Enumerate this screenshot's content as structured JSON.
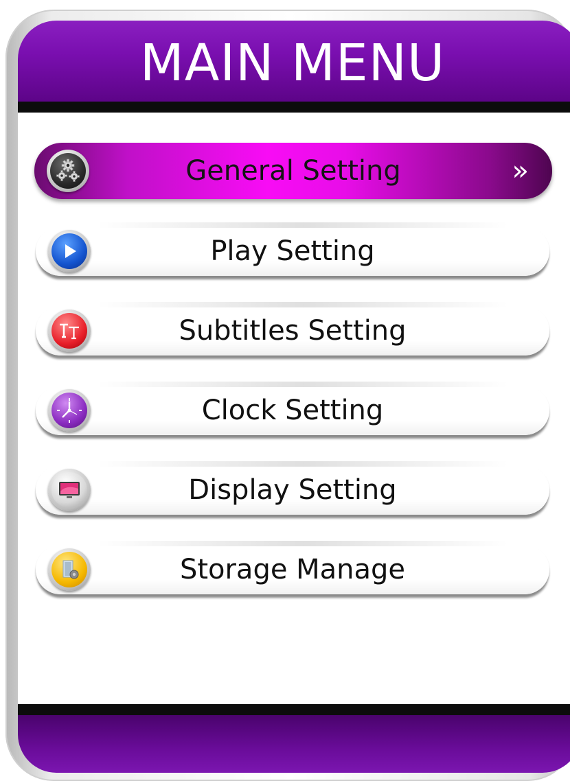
{
  "header": {
    "title": "MAIN MENU"
  },
  "menu": {
    "items": [
      {
        "label": "General Setting",
        "icon": "gear-icon",
        "selected": true
      },
      {
        "label": "Play Setting",
        "icon": "play-icon",
        "selected": false
      },
      {
        "label": "Subtitles Setting",
        "icon": "subtitles-icon",
        "selected": false
      },
      {
        "label": "Clock Setting",
        "icon": "clock-icon",
        "selected": false
      },
      {
        "label": "Display Setting",
        "icon": "display-icon",
        "selected": false
      },
      {
        "label": "Storage Manage",
        "icon": "storage-icon",
        "selected": false
      }
    ],
    "selected_indicator": "»"
  },
  "colors": {
    "header_purple": "#7a0fb0",
    "selected_magenta": "#f80cf5",
    "bar_black": "#0c0c0c"
  }
}
